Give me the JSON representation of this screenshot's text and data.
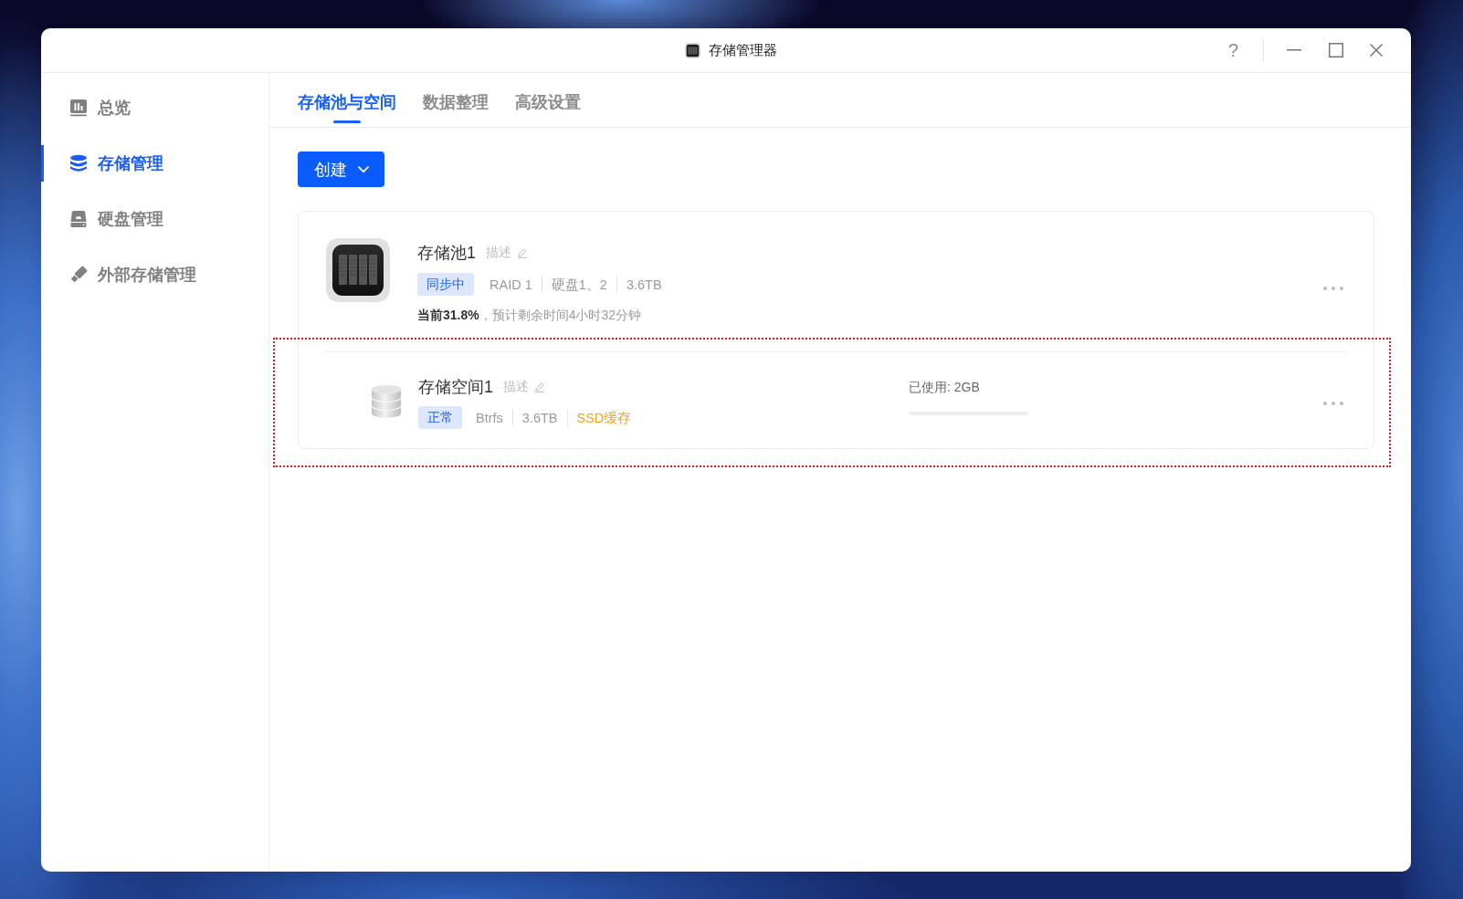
{
  "window": {
    "title": "存储管理器",
    "help_button": "?"
  },
  "sidebar": {
    "items": [
      {
        "kind": "overview",
        "label": "总览",
        "selected": false
      },
      {
        "kind": "storage",
        "label": "存储管理",
        "selected": true
      },
      {
        "kind": "disk",
        "label": "硬盘管理",
        "selected": false
      },
      {
        "kind": "external",
        "label": "外部存储管理",
        "selected": false
      }
    ]
  },
  "tabs": [
    {
      "label": "存储池与空间",
      "selected": true
    },
    {
      "label": "数据整理",
      "selected": false
    },
    {
      "label": "高级设置",
      "selected": false
    }
  ],
  "create_button": {
    "label": "创建"
  },
  "pool": {
    "name": "存储池1",
    "description": "描述",
    "status": "同步中",
    "details": [
      "RAID 1",
      "硬盘1、2",
      "3.6TB"
    ],
    "progress": "**当前31.8%**，预计剩余时间4小时32分钟"
  },
  "spaces": [
    {
      "name": "存储空间1",
      "description": "描述",
      "status": "正常",
      "details": [
        {
          "kind": "plain",
          "text": "Btrfs"
        },
        {
          "kind": "plain",
          "text": "3.6TB"
        },
        {
          "kind": "cache",
          "text": "SSD缓存"
        }
      ],
      "usage_label": "已使用: 2GB",
      "usage": {
        "level": 0
      },
      "highlighted": true
    }
  ]
}
